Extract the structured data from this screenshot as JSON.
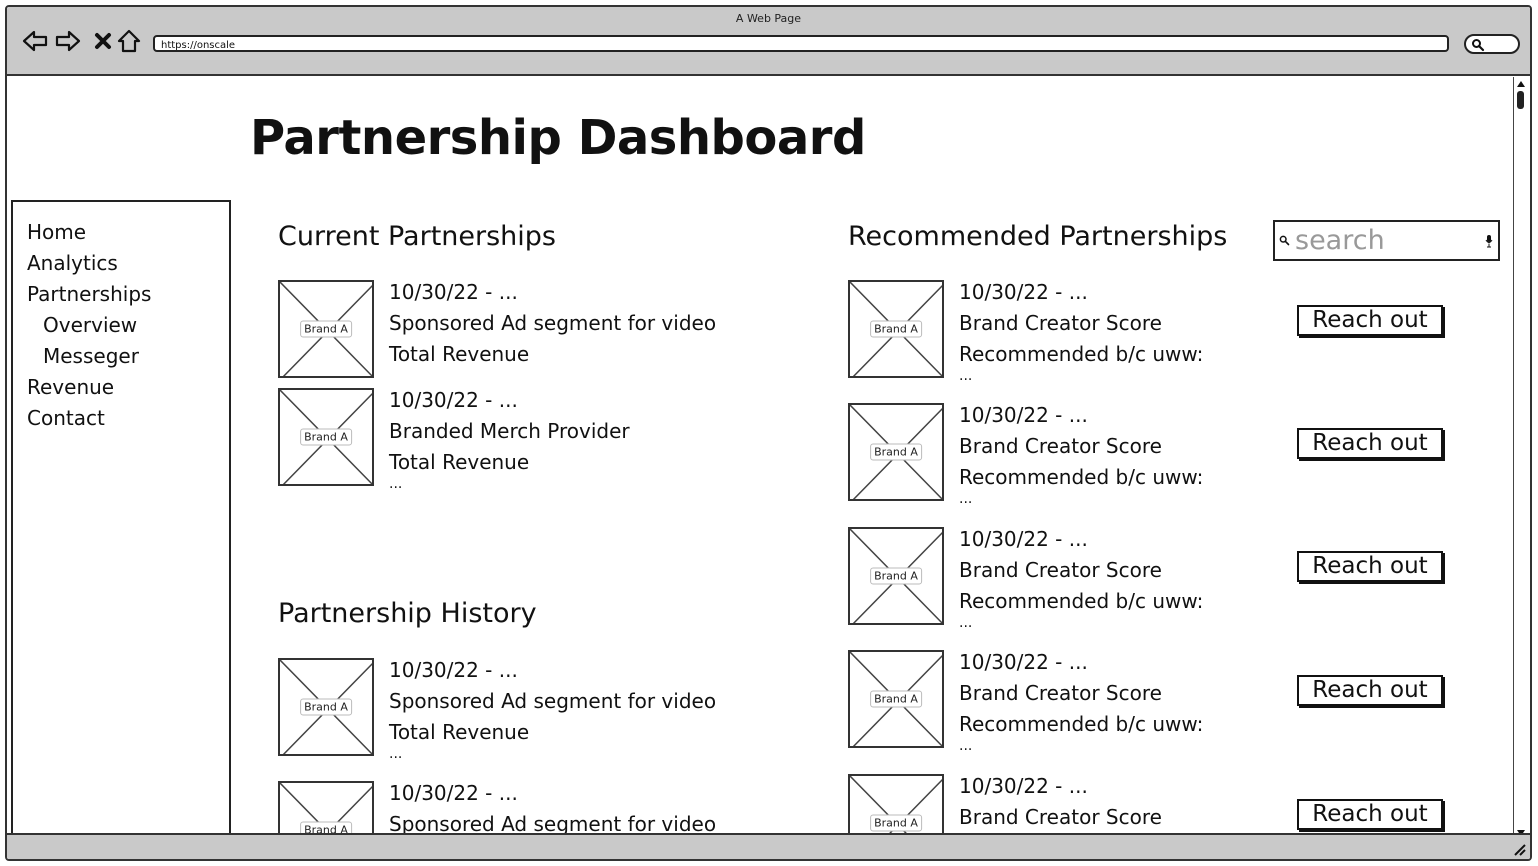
{
  "browser": {
    "window_title": "A Web Page",
    "url": "https://onscale"
  },
  "page": {
    "title": "Partnership Dashboard"
  },
  "sidebar": {
    "items": [
      {
        "label": "Home",
        "sub": false
      },
      {
        "label": "Analytics",
        "sub": false
      },
      {
        "label": "Partnerships",
        "sub": false
      },
      {
        "label": "Overview",
        "sub": true
      },
      {
        "label": "Messeger",
        "sub": true
      },
      {
        "label": "Revenue",
        "sub": false
      },
      {
        "label": "Contact",
        "sub": false
      }
    ]
  },
  "current": {
    "title": "Current Partnerships",
    "cards": [
      {
        "brand": "Brand A",
        "line1": "10/30/22 - ...",
        "line2": "Sponsored Ad segment for video",
        "line3": "Total Revenue",
        "more": ""
      },
      {
        "brand": "Brand A",
        "line1": "10/30/22 - ...",
        "line2": "Branded Merch Provider",
        "line3": "Total Revenue",
        "more": "..."
      }
    ]
  },
  "history": {
    "title": "Partnership History",
    "cards": [
      {
        "brand": "Brand A",
        "line1": "10/30/22 - ...",
        "line2": "Sponsored Ad segment for video",
        "line3": "Total Revenue",
        "more": "..."
      },
      {
        "brand": "Brand A",
        "line1": "10/30/22 - ...",
        "line2": "Sponsored Ad segment for video",
        "line3": "",
        "more": ""
      }
    ]
  },
  "recommended": {
    "title": "Recommended Partnerships",
    "search_placeholder": "search",
    "button_label": "Reach out",
    "cards": [
      {
        "brand": "Brand A",
        "line1": "10/30/22 - ...",
        "line2": "Brand Creator Score",
        "line3": "Recommended b/c uww:",
        "more": "..."
      },
      {
        "brand": "Brand A",
        "line1": "10/30/22 - ...",
        "line2": "Brand Creator Score",
        "line3": "Recommended b/c uww:",
        "more": "..."
      },
      {
        "brand": "Brand A",
        "line1": "10/30/22 - ...",
        "line2": "Brand Creator Score",
        "line3": "Recommended b/c uww:",
        "more": "..."
      },
      {
        "brand": "Brand A",
        "line1": "10/30/22 - ...",
        "line2": "Brand Creator Score",
        "line3": "Recommended b/c uww:",
        "more": "..."
      },
      {
        "brand": "Brand A",
        "line1": "10/30/22 - ...",
        "line2": "Brand Creator Score",
        "line3": "",
        "more": ""
      }
    ]
  },
  "icons": {
    "back": "back-arrow-icon",
    "forward": "forward-arrow-icon",
    "stop": "close-icon",
    "home": "home-icon",
    "search": "search-icon",
    "mic": "microphone-icon",
    "placeholder_image": "image-placeholder-icon"
  }
}
